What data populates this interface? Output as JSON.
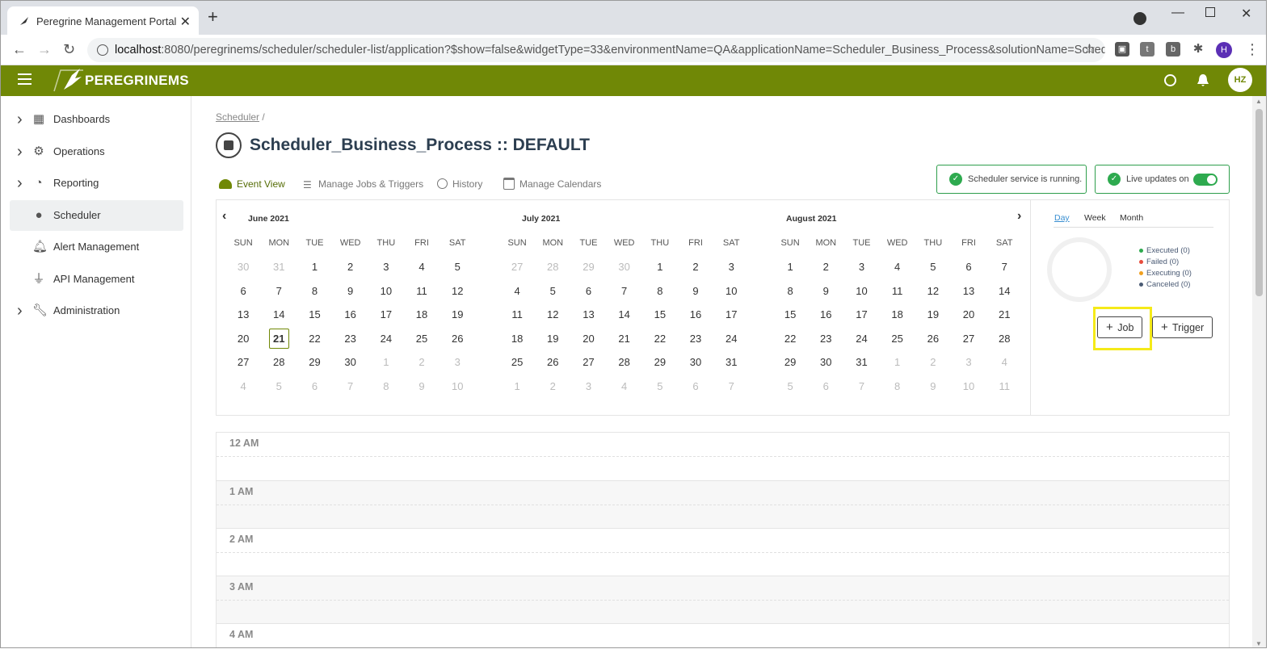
{
  "browser": {
    "tab_title": "Peregrine Management Portal",
    "url_host": "localhost",
    "url_rest": ":8080/peregrinems/scheduler/scheduler-list/application?$show=false&widgetType=33&environmentName=QA&applicationName=Scheduler_Business_Process&solutionName=Schedu...",
    "profile_initial": "H"
  },
  "app": {
    "brand": "PEREGRINEMS",
    "user_initials": "HZ",
    "accent": "#708806"
  },
  "sidebar": {
    "items": [
      {
        "label": "Dashboards",
        "icon": "dashboard-icon",
        "expandable": true
      },
      {
        "label": "Operations",
        "icon": "gear-icon",
        "expandable": true
      },
      {
        "label": "Reporting",
        "icon": "pie-chart-icon",
        "expandable": true
      },
      {
        "label": "Scheduler",
        "icon": "clock-icon",
        "active": true
      },
      {
        "label": "Alert Management",
        "icon": "bell-icon"
      },
      {
        "label": "API Management",
        "icon": "plug-icon"
      },
      {
        "label": "Administration",
        "icon": "wrench-icon",
        "expandable": true
      }
    ]
  },
  "page": {
    "breadcrumb": "Scheduler",
    "breadcrumb_sep": "/",
    "title": "Scheduler_Business_Process :: DEFAULT",
    "tabs": [
      "Event View",
      "Manage Jobs & Triggers",
      "History",
      "Manage Calendars"
    ],
    "status_running": "Scheduler service is running.",
    "status_live": "Live updates on"
  },
  "calendar": {
    "weekdays": [
      "SUN",
      "MON",
      "TUE",
      "WED",
      "THU",
      "FRI",
      "SAT"
    ],
    "months": [
      {
        "label": "June  2021",
        "first": 30,
        "prev_days": [
          30,
          31
        ],
        "days_in_month": 30,
        "next_days": [
          1,
          2,
          3,
          4,
          5,
          6,
          7,
          8,
          9,
          10
        ],
        "today": 21
      },
      {
        "label": "July  2021",
        "prev_days": [
          27,
          28,
          29,
          30
        ],
        "days_in_month": 31,
        "next_days": [
          1,
          2,
          3,
          4,
          5,
          6,
          7
        ]
      },
      {
        "label": "August  2021",
        "prev_days": [],
        "days_in_month": 31,
        "next_days": [
          1,
          2,
          3,
          4,
          5,
          6,
          7,
          8,
          9,
          10,
          11
        ]
      }
    ]
  },
  "summary": {
    "view_modes": [
      "Day",
      "Week",
      "Month"
    ],
    "legend": [
      {
        "label": "Executed (0)",
        "color": "#2eaa4f"
      },
      {
        "label": "Failed (0)",
        "color": "#e74c3c"
      },
      {
        "label": "Executing (0)",
        "color": "#f0a020"
      },
      {
        "label": "Canceled (0)",
        "color": "#4a5a74"
      }
    ],
    "add_job": "Job",
    "add_trigger": "Trigger"
  },
  "agenda": {
    "hours": [
      "12 AM",
      "1 AM",
      "2 AM",
      "3 AM",
      "4 AM"
    ]
  }
}
